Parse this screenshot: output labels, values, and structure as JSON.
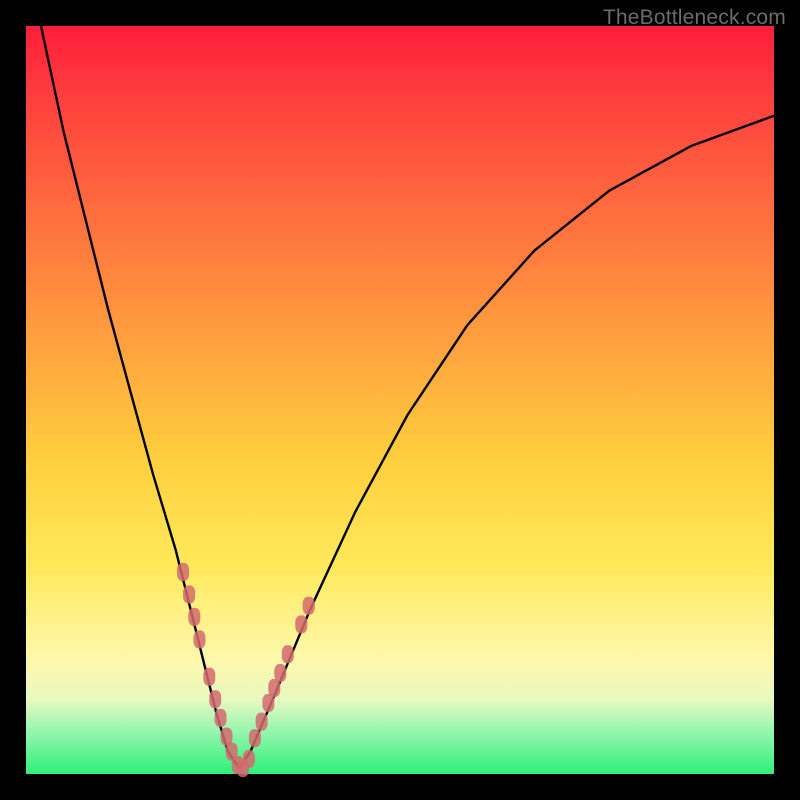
{
  "watermark": "TheBottleneck.com",
  "chart_data": {
    "type": "line",
    "title": "",
    "xlabel": "",
    "ylabel": "",
    "xlim": [
      0,
      100
    ],
    "ylim": [
      0,
      100
    ],
    "series": [
      {
        "name": "bottleneck-curve",
        "x": [
          2,
          5,
          8,
          11,
          14,
          17,
          20,
          22,
          24,
          25.5,
          27,
          28.5,
          30,
          33,
          38,
          44,
          51,
          59,
          68,
          78,
          89,
          100
        ],
        "y": [
          100,
          86,
          74,
          62,
          51,
          40,
          30,
          22,
          14,
          8,
          3,
          0.8,
          3,
          10,
          22,
          35,
          48,
          60,
          70,
          78,
          84,
          88
        ]
      }
    ],
    "markers": {
      "name": "highlight-points",
      "color": "#d46a6f",
      "points": [
        {
          "x": 21.0,
          "y": 27.0
        },
        {
          "x": 21.8,
          "y": 24.0
        },
        {
          "x": 22.5,
          "y": 21.0
        },
        {
          "x": 23.2,
          "y": 18.0
        },
        {
          "x": 24.5,
          "y": 13.0
        },
        {
          "x": 25.3,
          "y": 10.0
        },
        {
          "x": 26.0,
          "y": 7.5
        },
        {
          "x": 26.8,
          "y": 5.0
        },
        {
          "x": 27.5,
          "y": 3.0
        },
        {
          "x": 28.3,
          "y": 1.2
        },
        {
          "x": 29.0,
          "y": 0.8
        },
        {
          "x": 29.8,
          "y": 2.0
        },
        {
          "x": 30.6,
          "y": 4.8
        },
        {
          "x": 31.5,
          "y": 7.0
        },
        {
          "x": 32.4,
          "y": 9.5
        },
        {
          "x": 33.2,
          "y": 11.5
        },
        {
          "x": 34.0,
          "y": 13.5
        },
        {
          "x": 35.0,
          "y": 16.0
        },
        {
          "x": 36.8,
          "y": 20.0
        },
        {
          "x": 37.8,
          "y": 22.5
        }
      ]
    },
    "background_gradient": {
      "top": "#ff1e3c",
      "upper_mid": "#ff9a3e",
      "mid": "#ffcf3e",
      "lower_mid": "#fff7a8",
      "bottom": "#2ef07a"
    }
  }
}
